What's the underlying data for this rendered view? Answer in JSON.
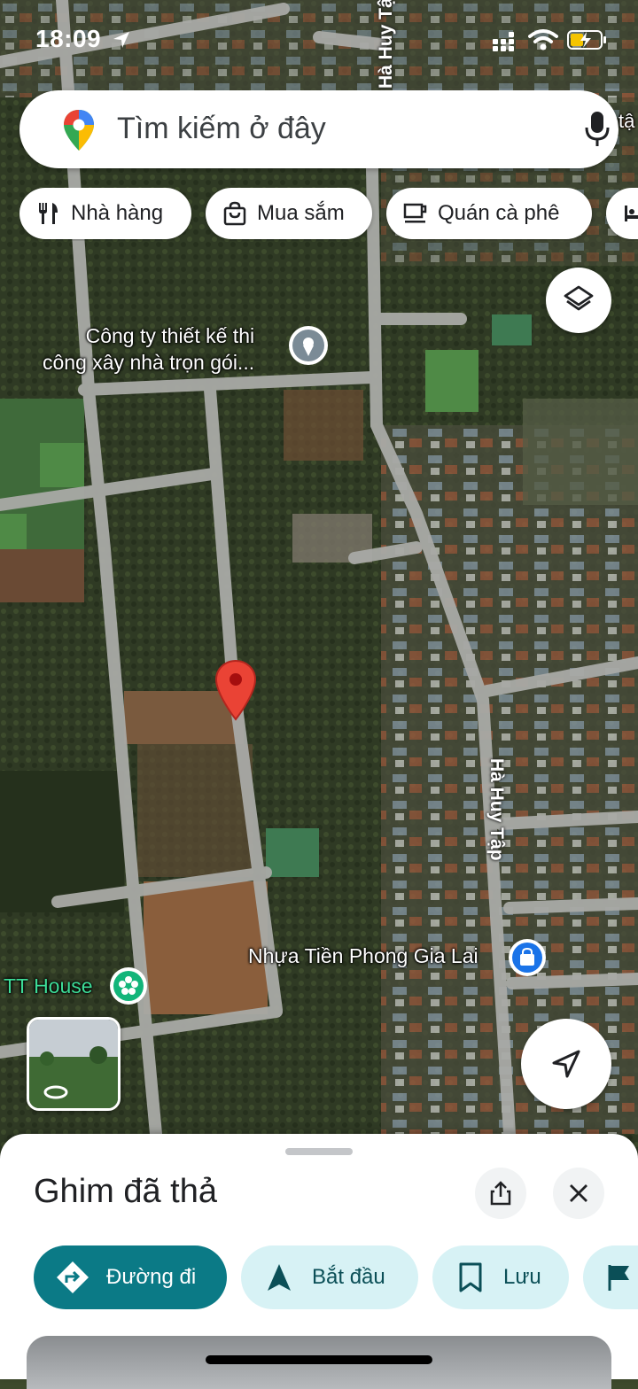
{
  "status_bar": {
    "time": "18:09"
  },
  "search": {
    "placeholder": "Tìm kiếm ở đây"
  },
  "chips": [
    {
      "label": "Nhà hàng",
      "icon": "restaurant-icon"
    },
    {
      "label": "Mua sắm",
      "icon": "shopping-bag-icon"
    },
    {
      "label": "Quán cà phê",
      "icon": "coffee-icon"
    },
    {
      "label": "",
      "icon": "hotel-icon"
    }
  ],
  "map": {
    "place_company": "Công ty thiết kế thi\ncông xây nhà trọn gói...",
    "place_nhua": "Nhựa Tiền Phong Gia Lai",
    "place_tt": "TT House",
    "street_top": "Hà Huy Tậ",
    "street_mid": "Hà Huy Tập",
    "edge_text": "tậ"
  },
  "sheet": {
    "title": "Ghim đã thả",
    "actions": [
      {
        "label": "Đường đi",
        "icon": "directions-icon"
      },
      {
        "label": "Bắt đầu",
        "icon": "navigation-arrow-icon"
      },
      {
        "label": "Lưu",
        "icon": "bookmark-icon"
      },
      {
        "label": "",
        "icon": "flag-icon"
      }
    ]
  },
  "colors": {
    "primary": "#0b7a86",
    "chip_tint": "#d7f2f5",
    "pin_red": "#ea4335",
    "road": "#a9aaa6"
  }
}
